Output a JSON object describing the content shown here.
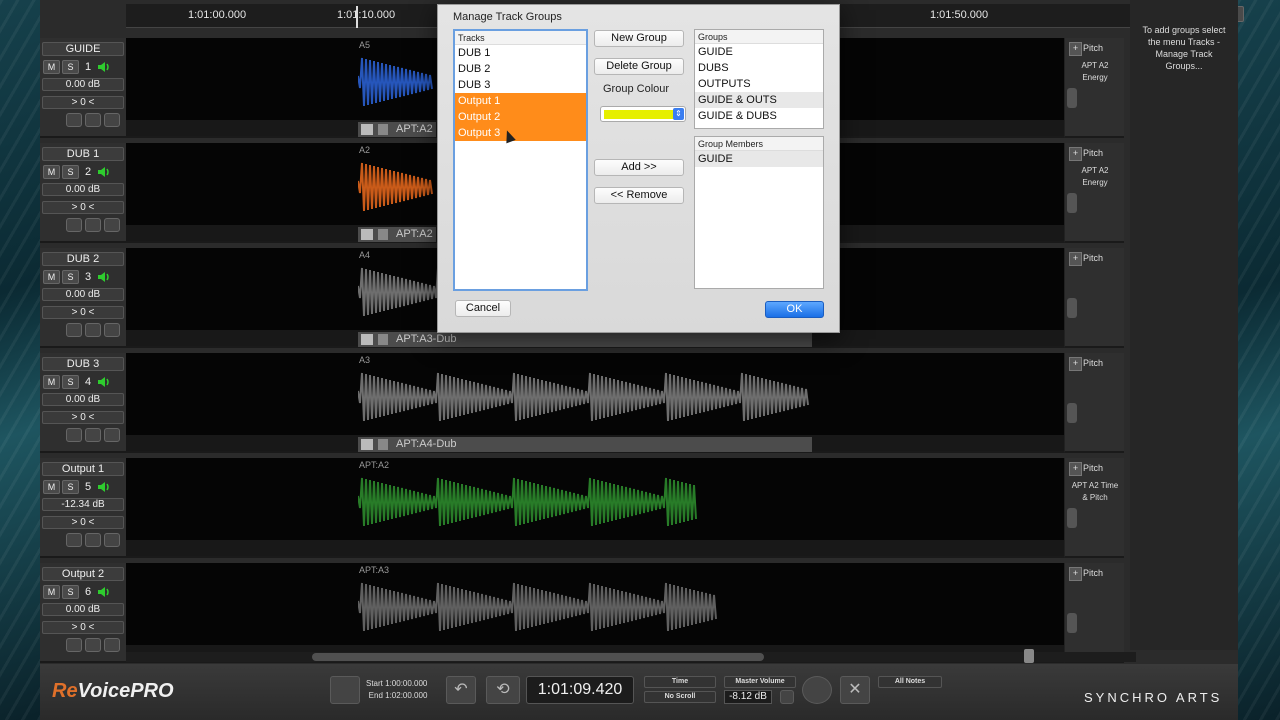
{
  "ruler": {
    "ticks": [
      "1:01:00.000",
      "1:01:10.000",
      "1:01:50.000"
    ]
  },
  "tracks": [
    {
      "name": "GUIDE",
      "number": "1",
      "volume": "0.00 dB",
      "pan": "> 0 <",
      "clip_label": "APT:A2",
      "lane_tag": "A5",
      "pitch": "Pitch",
      "info": "APT A2 Energy"
    },
    {
      "name": "DUB 1",
      "number": "2",
      "volume": "0.00 dB",
      "pan": "> 0 <",
      "clip_label": "APT:A2",
      "lane_tag": "A2",
      "pitch": "Pitch",
      "info": "APT A2 Energy"
    },
    {
      "name": "DUB 2",
      "number": "3",
      "volume": "0.00 dB",
      "pan": "> 0 <",
      "clip_label": "APT:A3-Dub",
      "lane_tag": "A4",
      "pitch": "Pitch",
      "info": ""
    },
    {
      "name": "DUB 3",
      "number": "4",
      "volume": "0.00 dB",
      "pan": "> 0 <",
      "clip_label": "APT:A4-Dub",
      "lane_tag": "A3",
      "pitch": "Pitch",
      "info": ""
    },
    {
      "name": "Output 1",
      "number": "5",
      "volume": "-12.34 dB",
      "pan": "> 0 <",
      "clip_label": "",
      "lane_tag": "APT:A2",
      "pitch": "Pitch",
      "info": "APT A2 Time & Pitch"
    },
    {
      "name": "Output 2",
      "number": "6",
      "volume": "0.00 dB",
      "pan": "> 0 <",
      "clip_label": "",
      "lane_tag": "APT:A3",
      "pitch": "Pitch",
      "info": ""
    }
  ],
  "buttons": {
    "mute": "M",
    "solo": "S"
  },
  "help_text": "To add groups select the menu Tracks - Manage Track Groups...",
  "bottom": {
    "logo_re": "Re",
    "logo_rest": "VoicePRO",
    "start_label": "Start 1:00:00.000",
    "end_label": "End 1:02:00.000",
    "timecode": "1:01:09.420",
    "time_select": "Time",
    "scroll_select": "No Scroll",
    "master_volume_label": "Master Volume",
    "master_volume": "-8.12 dB",
    "notes_select": "All Notes",
    "brand": "SYNCHRO ARTS"
  },
  "dialog": {
    "title": "Manage Track Groups",
    "tracks_header": "Tracks",
    "tracks": [
      "DUB 1",
      "DUB 2",
      "DUB 3",
      "Output 1",
      "Output 2",
      "Output 3"
    ],
    "new_group": "New Group",
    "delete_group": "Delete Group",
    "group_colour_label": "Group Colour",
    "group_colour": "#e6ef00",
    "add": "Add >>",
    "remove": "<< Remove",
    "groups_header": "Groups",
    "groups": [
      "GUIDE",
      "DUBS",
      "OUTPUTS",
      "GUIDE & OUTS",
      "GUIDE & DUBS"
    ],
    "members_header": "Group Members",
    "members": [
      "GUIDE"
    ],
    "cancel": "Cancel",
    "ok": "OK"
  },
  "colors": {
    "selection": "#ff8c1a",
    "accent_blue": "#1a6fe6",
    "meter_green": "#2ecc2e"
  }
}
